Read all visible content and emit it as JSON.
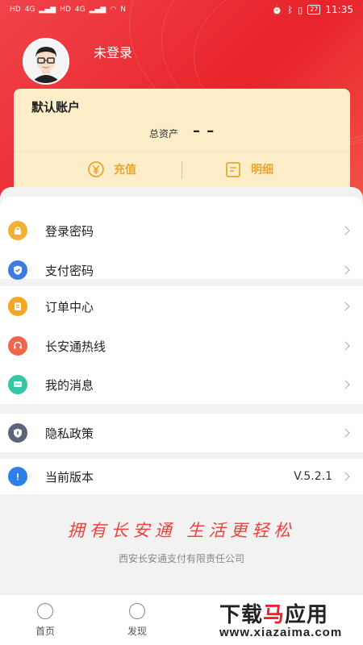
{
  "status_bar": {
    "left_labels": [
      "HD",
      "4G",
      "HD",
      "4G"
    ],
    "battery": "27",
    "time": "11:35"
  },
  "profile": {
    "login_status": "未登录"
  },
  "account": {
    "title": "默认账户",
    "total_assets_label": "总资产",
    "total_assets_value": "– –",
    "recharge_label": "充值",
    "detail_label": "明细"
  },
  "menu": {
    "login_password": "登录密码",
    "pay_password": "支付密码",
    "order_center": "订单中心",
    "hotline": "长安通热线",
    "messages": "我的消息",
    "privacy_policy": "隐私政策",
    "current_version": "当前版本",
    "version_value": "V.5.2.1"
  },
  "footer": {
    "slogan": "拥有长安通 生活更轻松",
    "company": "西安长安通支付有限责任公司"
  },
  "tabbar": {
    "home": "首页",
    "discover": "发现"
  },
  "watermark": {
    "title_a": "下载",
    "title_b": "马",
    "title_c": "应用",
    "url": "www.xiazaima.com"
  },
  "colors": {
    "brand_red": "#e8232b",
    "card_bg": "#fdeec9",
    "gold": "#e8a62f",
    "icon_lock": "#f2b135",
    "icon_shield": "#3d7be0",
    "icon_order": "#f5a623",
    "icon_hotline": "#f0664a",
    "icon_message": "#34c7a6",
    "icon_privacy": "#5b6478",
    "icon_version": "#2f7fe8"
  }
}
